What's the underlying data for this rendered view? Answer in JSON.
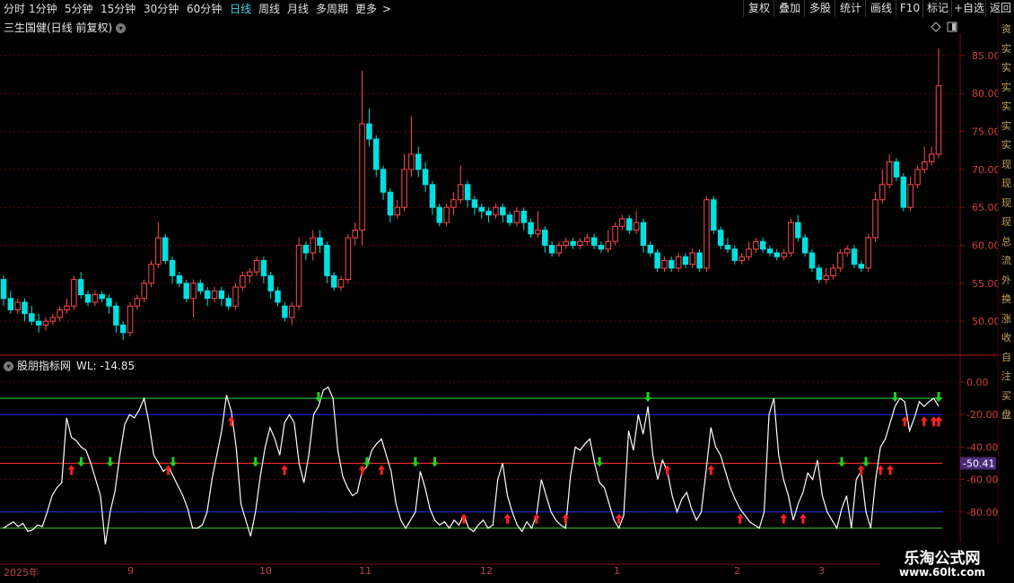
{
  "toolbar": {
    "periods": [
      "分时",
      "1分钟",
      "5分钟",
      "15分钟",
      "30分钟",
      "60分钟",
      "日线",
      "周线",
      "月线",
      "多周期",
      "更多"
    ],
    "active_period": "日线",
    "right_buttons": [
      "复权",
      "叠加",
      "多股",
      "统计",
      "画线",
      "F10",
      "标记",
      "+自选",
      "返回"
    ]
  },
  "main_chart": {
    "title": "三生国健(日线 前复权)",
    "price_ticks": [
      "85.00",
      "80.00",
      "75.00",
      "70.00",
      "65.00",
      "60.00",
      "55.00",
      "50.00"
    ]
  },
  "indicator": {
    "name": "股朋指标网",
    "wl_label": "WL:",
    "wl_value": "-14.85",
    "ticks": [
      "0.00",
      "-20.00",
      "-40.00",
      "-60.00",
      "-80.00"
    ],
    "current_value": "-50.41"
  },
  "x_axis": [
    "2025年",
    "9",
    "10",
    "11",
    "12",
    "1",
    "2",
    "3"
  ],
  "right_column_chars": [
    "资",
    "实",
    "实",
    "实",
    "实",
    "实",
    "实",
    "现",
    "现",
    "现",
    "现",
    "总",
    "流",
    "外",
    "换",
    "涨",
    "收",
    "自",
    "注",
    "买",
    "盘"
  ],
  "watermark": {
    "line1": "乐淘公式网",
    "line2": "www.60lt.com"
  },
  "colors": {
    "up": "#ff4b4b",
    "down": "#00e0e0",
    "green_line": "#3ad23a",
    "blue_line": "#1c2dff",
    "red_line": "#ff3030",
    "badge": "#4a2a7a"
  },
  "chart_data": {
    "type": "candlestick",
    "title": "三生国健(日线 前复权)",
    "ylim": [
      46,
      87
    ],
    "candles": [
      [
        55.5,
        53.0,
        56.0,
        52.0
      ],
      [
        53,
        51.5,
        54,
        51
      ],
      [
        51.5,
        52.5,
        53,
        51
      ],
      [
        52.5,
        51,
        53,
        50
      ],
      [
        51,
        50,
        52,
        49.5
      ],
      [
        50,
        49.5,
        51,
        48.5
      ],
      [
        49.5,
        50,
        50.5,
        48.8
      ],
      [
        50,
        50.5,
        51,
        49.5
      ],
      [
        50.5,
        51.5,
        52,
        50
      ],
      [
        51.5,
        52,
        53,
        51
      ],
      [
        52,
        55.5,
        56,
        51.5
      ],
      [
        55.5,
        53.5,
        56.5,
        53
      ],
      [
        53.5,
        52.5,
        54,
        52
      ],
      [
        52.5,
        53.5,
        54,
        52
      ],
      [
        53.5,
        53,
        54,
        52.5
      ],
      [
        53,
        52,
        53.5,
        51
      ],
      [
        52,
        49.5,
        52.5,
        48.5
      ],
      [
        49.5,
        48.5,
        50,
        47.5
      ],
      [
        48.5,
        52,
        52.5,
        48
      ],
      [
        52,
        53,
        53.5,
        51.5
      ],
      [
        53,
        55,
        55.5,
        52.5
      ],
      [
        55,
        57.5,
        58,
        54.5
      ],
      [
        57.5,
        61,
        63,
        57
      ],
      [
        61,
        58,
        61.5,
        57.5
      ],
      [
        58,
        56,
        58.5,
        55
      ],
      [
        56,
        55,
        56.5,
        54.5
      ],
      [
        55,
        53,
        55.5,
        52.5
      ],
      [
        53,
        55,
        55.5,
        50.5
      ],
      [
        55,
        54,
        55.5,
        53.5
      ],
      [
        54,
        53,
        54.5,
        52
      ],
      [
        53,
        54,
        54.5,
        52.5
      ],
      [
        54,
        53,
        54.5,
        52
      ],
      [
        53,
        52,
        53.5,
        51.5
      ],
      [
        52,
        54.5,
        55,
        51.5
      ],
      [
        54.5,
        56,
        56.5,
        54
      ],
      [
        56,
        56.5,
        57,
        55
      ],
      [
        56.5,
        58,
        58.5,
        56
      ],
      [
        58,
        56,
        58.5,
        55
      ],
      [
        56,
        54,
        56.5,
        53
      ],
      [
        54,
        52.5,
        54.5,
        52
      ],
      [
        52,
        50.5,
        52.5,
        50
      ],
      [
        50.5,
        52,
        52.5,
        49.5
      ],
      [
        52,
        60,
        61,
        51.5
      ],
      [
        60,
        59,
        60.5,
        58
      ],
      [
        59,
        61,
        62,
        58
      ],
      [
        61,
        60,
        62,
        59
      ],
      [
        60,
        56,
        60.5,
        55
      ],
      [
        56,
        54.5,
        56.5,
        54
      ],
      [
        54.5,
        55.5,
        56,
        54
      ],
      [
        55.5,
        61,
        61.5,
        55
      ],
      [
        61,
        62,
        63,
        60
      ],
      [
        62,
        76,
        83,
        60
      ],
      [
        76,
        74,
        78,
        73
      ],
      [
        74,
        70,
        74.5,
        69
      ],
      [
        70,
        67,
        70.5,
        66
      ],
      [
        67,
        64,
        67.5,
        63
      ],
      [
        64,
        65,
        66,
        63.5
      ],
      [
        65,
        70,
        72,
        64.5
      ],
      [
        70,
        72,
        77,
        69
      ],
      [
        72,
        70,
        73,
        69
      ],
      [
        70,
        68,
        71,
        67
      ],
      [
        68,
        65,
        68.5,
        64
      ],
      [
        65,
        63,
        65.5,
        62.5
      ],
      [
        63,
        65,
        65.5,
        62.5
      ],
      [
        65,
        66,
        67,
        64
      ],
      [
        66,
        68,
        70.5,
        65.5
      ],
      [
        68,
        66,
        68.5,
        65
      ],
      [
        66,
        65,
        66.5,
        64
      ],
      [
        65,
        64.5,
        65.5,
        63.5
      ],
      [
        64.5,
        64,
        65,
        63
      ],
      [
        64,
        65,
        65.5,
        63.5
      ],
      [
        65,
        64,
        65.5,
        63
      ],
      [
        64,
        63,
        64.5,
        62.5
      ],
      [
        63,
        64.5,
        65,
        62.5
      ],
      [
        64.5,
        63,
        65,
        62
      ],
      [
        63,
        61.5,
        63.5,
        61
      ],
      [
        61.5,
        62,
        64.5,
        61
      ],
      [
        62,
        60,
        62.5,
        59
      ],
      [
        60,
        59,
        60.5,
        58.5
      ],
      [
        59,
        60,
        60.5,
        58.5
      ],
      [
        60,
        60.5,
        61,
        59.5
      ],
      [
        60.5,
        60,
        61,
        59.5
      ],
      [
        60,
        60.5,
        61,
        59.5
      ],
      [
        60.5,
        61,
        61.5,
        60
      ],
      [
        61,
        60,
        61.5,
        59.5
      ],
      [
        60,
        59.5,
        60.5,
        59
      ],
      [
        59.5,
        60.5,
        62,
        59
      ],
      [
        60.5,
        62.5,
        63,
        60
      ],
      [
        62.5,
        63.5,
        64,
        62
      ],
      [
        63.5,
        62,
        64,
        61.5
      ],
      [
        62,
        63,
        64.5,
        61.5
      ],
      [
        63,
        60,
        63.5,
        59
      ],
      [
        60,
        59,
        60.5,
        58.5
      ],
      [
        59,
        57,
        59.5,
        56.5
      ],
      [
        57,
        58,
        58.5,
        56.5
      ],
      [
        58,
        57,
        58.5,
        56.5
      ],
      [
        57,
        58.5,
        59,
        56.5
      ],
      [
        58.5,
        57.5,
        59,
        57
      ],
      [
        57.5,
        59,
        59.5,
        57
      ],
      [
        59,
        57,
        59.5,
        56.5
      ],
      [
        57,
        66,
        66.5,
        56.5
      ],
      [
        66,
        62,
        66.5,
        61.5
      ],
      [
        62,
        60,
        62.5,
        59.5
      ],
      [
        60,
        59.5,
        61,
        59
      ],
      [
        59.5,
        58,
        60,
        57.5
      ],
      [
        58,
        58.5,
        59,
        57.5
      ],
      [
        58.5,
        59.5,
        60.5,
        58
      ],
      [
        59.5,
        60.5,
        61,
        59
      ],
      [
        60.5,
        59.5,
        61,
        59
      ],
      [
        59.5,
        59,
        60,
        58.5
      ],
      [
        59,
        58.5,
        59.5,
        58
      ],
      [
        58.5,
        59,
        59.5,
        58
      ],
      [
        59,
        63,
        63.5,
        58.5
      ],
      [
        63,
        61,
        64,
        60.5
      ],
      [
        61,
        59,
        61.5,
        58.5
      ],
      [
        59,
        57,
        59.5,
        56.5
      ],
      [
        57,
        55.5,
        57.5,
        55
      ],
      [
        55.5,
        56,
        57,
        55
      ],
      [
        56,
        57,
        57.5,
        55.5
      ],
      [
        57,
        59,
        59.5,
        56.5
      ],
      [
        59,
        59.5,
        60,
        58.5
      ],
      [
        59.5,
        57.5,
        60,
        57
      ],
      [
        57.5,
        57,
        58,
        56.5
      ],
      [
        57,
        61,
        61.5,
        56.5
      ],
      [
        61,
        66,
        67,
        60.5
      ],
      [
        66,
        68,
        70,
        65.5
      ],
      [
        68,
        71,
        72,
        67.5
      ],
      [
        71,
        69,
        71.5,
        68.5
      ],
      [
        69,
        65,
        69.5,
        64.5
      ],
      [
        65,
        68,
        69,
        64.5
      ],
      [
        68,
        70,
        70.5,
        67.5
      ],
      [
        70,
        71,
        73,
        69.5
      ],
      [
        71,
        72,
        73,
        70.5
      ],
      [
        72,
        81,
        86,
        71.5
      ]
    ],
    "indicator_series": {
      "name": "WL",
      "ylim": [
        -100,
        5
      ],
      "reference_lines": [
        -10,
        -20,
        -50,
        -80,
        -90
      ],
      "values": [
        -90,
        -88,
        -86,
        -89,
        -87,
        -92,
        -91,
        -88,
        -89,
        -80,
        -70,
        -65,
        -62,
        -22,
        -34,
        -36,
        -40,
        -42,
        -50,
        -60,
        -70,
        -100,
        -80,
        -67,
        -45,
        -26,
        -20,
        -22,
        -17,
        -10,
        -25,
        -45,
        -50,
        -55,
        -52,
        -58,
        -64,
        -70,
        -78,
        -90,
        -90,
        -88,
        -80,
        -60,
        -45,
        -30,
        -8,
        -18,
        -40,
        -75,
        -85,
        -95,
        -80,
        -58,
        -40,
        -28,
        -35,
        -45,
        -25,
        -20,
        -25,
        -50,
        -62,
        -45,
        -20,
        -15,
        -5,
        -3,
        -10,
        -42,
        -58,
        -65,
        -70,
        -68,
        -55,
        -52,
        -42,
        -38,
        -35,
        -45,
        -55,
        -75,
        -85,
        -90,
        -85,
        -80,
        -55,
        -65,
        -78,
        -85,
        -88,
        -86,
        -90,
        -85,
        -88,
        -82,
        -90,
        -92,
        -88,
        -85,
        -90,
        -88,
        -60,
        -50,
        -70,
        -80,
        -88,
        -92,
        -86,
        -90,
        -82,
        -60,
        -70,
        -80,
        -85,
        -88,
        -90,
        -58,
        -40,
        -42,
        -38,
        -35,
        -50,
        -62,
        -65,
        -75,
        -85,
        -90,
        -82,
        -30,
        -42,
        -20,
        -32,
        -15,
        -45,
        -60,
        -48,
        -55,
        -70,
        -80,
        -72,
        -68,
        -78,
        -85,
        -80,
        -55,
        -28,
        -40,
        -45,
        -55,
        -65,
        -72,
        -78,
        -82,
        -86,
        -88,
        -90,
        -80,
        -20,
        -10,
        -45,
        -60,
        -70,
        -85,
        -75,
        -68,
        -56,
        -60,
        -48,
        -70,
        -80,
        -85,
        -90,
        -78,
        -70,
        -90,
        -60,
        -55,
        -80,
        -90,
        -60,
        -40,
        -35,
        -25,
        -15,
        -10,
        -12,
        -30,
        -22,
        -12,
        -15,
        -12,
        -10,
        -14.85
      ]
    },
    "signals": {
      "up_arrow_indices": [
        14,
        34,
        47,
        58,
        74,
        78,
        95,
        104,
        110,
        116,
        127,
        137,
        146,
        152,
        161,
        165,
        177,
        181,
        183,
        186,
        190,
        192,
        195,
        201,
        203,
        205,
        207,
        211,
        213,
        215,
        218,
        223,
        227,
        230
      ],
      "down_arrow_indices": [
        16,
        22,
        35,
        52,
        65,
        75,
        85,
        89,
        123,
        133,
        173,
        178,
        184,
        195,
        200,
        211
      ]
    }
  }
}
